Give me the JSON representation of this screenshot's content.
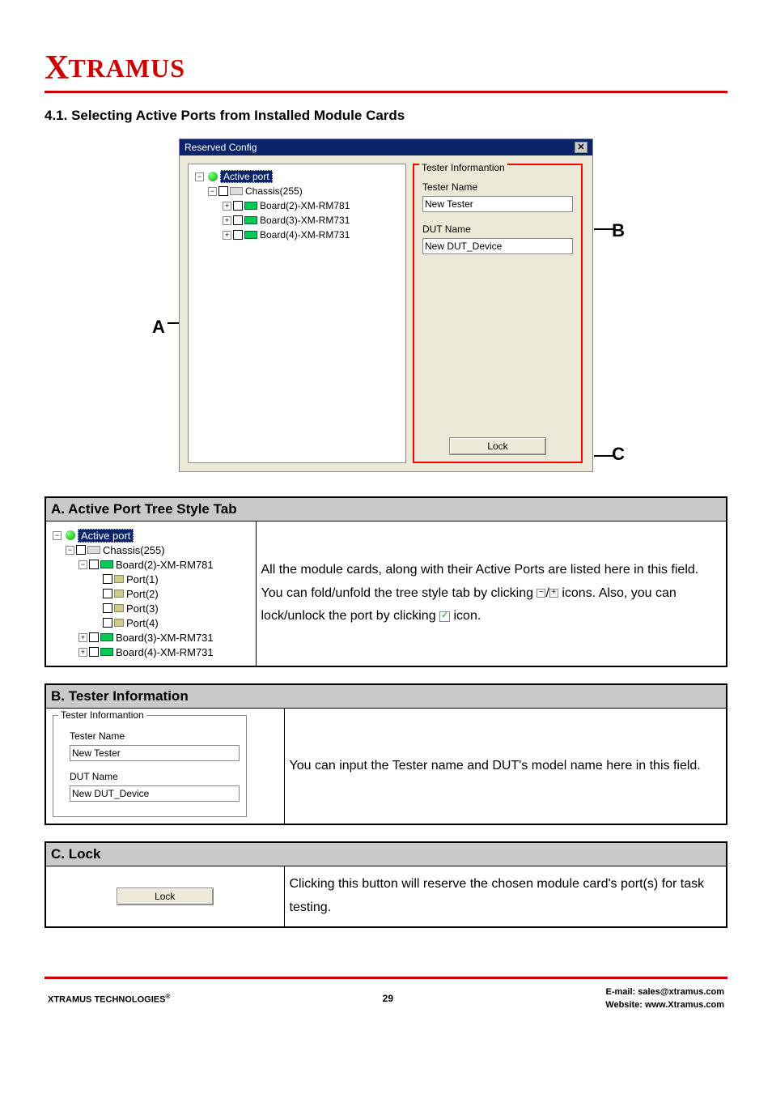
{
  "logo": {
    "x": "X",
    "rest": "TRAMUS"
  },
  "section_title": "4.1. Selecting Active Ports from Installed Module Cards",
  "callouts": {
    "a": "A",
    "b": "B",
    "c": "C"
  },
  "dialog": {
    "title": "Reserved Config",
    "tree": {
      "root": "Active port",
      "chassis": "Chassis(255)",
      "boards": [
        "Board(2)-XM-RM781",
        "Board(3)-XM-RM731",
        "Board(4)-XM-RM731"
      ]
    },
    "info": {
      "legend": "Tester Informantion",
      "tester_label": "Tester Name",
      "tester_value": "New Tester",
      "dut_label": "DUT Name",
      "dut_value": "New DUT_Device"
    },
    "lock": "Lock"
  },
  "tableA": {
    "header": "A. Active Port Tree Style Tab",
    "tree": {
      "root": "Active port",
      "chassis": "Chassis(255)",
      "board2": "Board(2)-XM-RM781",
      "ports": [
        "Port(1)",
        "Port(2)",
        "Port(3)",
        "Port(4)"
      ],
      "board3": "Board(3)-XM-RM731",
      "board4": "Board(4)-XM-RM731"
    },
    "desc_p1": "All the module cards, along with their Active Ports are listed here in this field. You can fold/unfold the tree style tab by clicking ",
    "desc_p2": " icons. Also, you can lock/unlock the port by clicking ",
    "desc_p3": " icon.",
    "minus": "−",
    "slash": "/",
    "plus": "+",
    "check": "✓"
  },
  "tableB": {
    "header": "B. Tester Information",
    "legend": "Tester Informantion",
    "tester_label": "Tester Name",
    "tester_value": "New Tester",
    "dut_label": "DUT Name",
    "dut_value": "New DUT_Device",
    "desc": "You can input the Tester name and DUT's model name here in this field."
  },
  "tableC": {
    "header": "C. Lock",
    "button": "Lock",
    "desc": "Clicking this button will reserve the chosen module card's port(s) for task testing."
  },
  "footer": {
    "left": "XTRAMUS TECHNOLOGIES",
    "reg": "®",
    "page": "29",
    "email_lbl": "E-mail: ",
    "email": "sales@xtramus.com",
    "web_lbl": "Website:  ",
    "web": "www.Xtramus.com"
  },
  "sym": {
    "plus": "+",
    "minus": "−"
  }
}
